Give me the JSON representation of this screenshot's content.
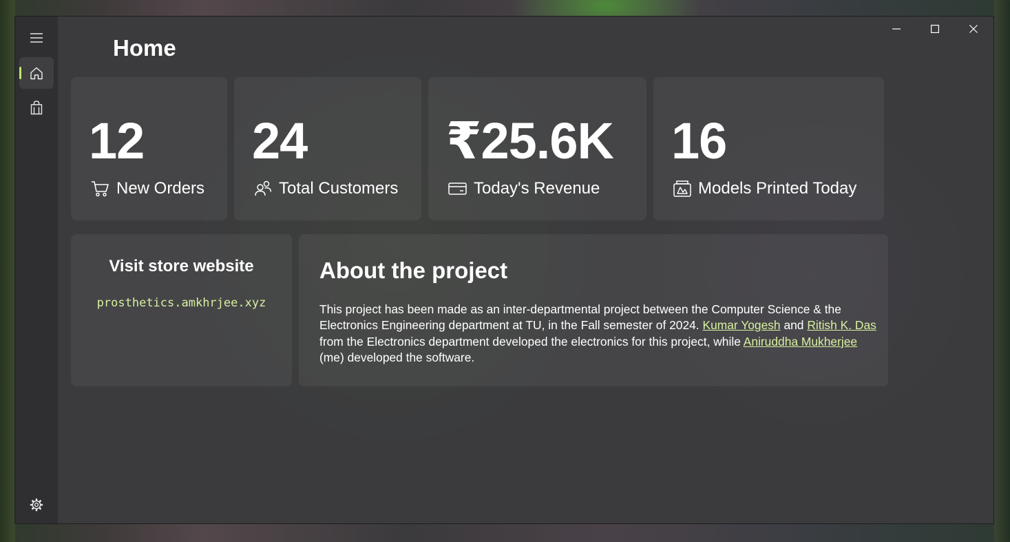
{
  "window": {
    "title": "Home",
    "controls": {
      "minimize_icon": "minimize-icon",
      "maximize_icon": "maximize-icon",
      "close_icon": "close-icon"
    }
  },
  "nav": {
    "menu_icon": "hamburger-icon",
    "items": [
      {
        "icon": "home-icon",
        "selected": true
      },
      {
        "icon": "shopping-bag-icon",
        "selected": false
      }
    ],
    "settings_icon": "gear-icon",
    "accent": "#bfe86b"
  },
  "stats": [
    {
      "value": "12",
      "label": "New Orders",
      "icon": "cart-icon"
    },
    {
      "value": "24",
      "label": "Total Customers",
      "icon": "people-icon"
    },
    {
      "value": "₹25.6K",
      "label": "Today's Revenue",
      "icon": "credit-card-icon"
    },
    {
      "value": "16",
      "label": "Models Printed Today",
      "icon": "print-model-icon"
    }
  ],
  "visit": {
    "title": "Visit store website",
    "link": "prosthetics.amkhrjee.xyz"
  },
  "about": {
    "title": "About the project",
    "text_1": "This project has been made as an inter-departmental project between the Computer Science & the Electronics Engineering department at TU, in the Fall semester of 2024.",
    "link_1": "Kumar Yogesh",
    "text_2": "and",
    "link_2": "Ritish K. Das",
    "text_3": "from the Electronics department developed the electronics for this project, while",
    "link_3": "Aniruddha Mukherjee",
    "text_4": "(me) developed the software."
  },
  "colors": {
    "link": "#d8f0a0",
    "card": "#434345",
    "window": "#3a3a3d"
  }
}
